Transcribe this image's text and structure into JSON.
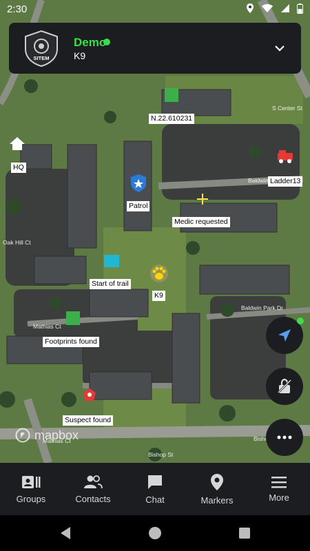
{
  "status_bar": {
    "time": "2:30"
  },
  "header": {
    "group_name": "Demo",
    "subtitle": "K9",
    "logo_text": "SITEM"
  },
  "map": {
    "markers": [
      {
        "label": "N.22.610231",
        "icon": "green-square-icon"
      },
      {
        "label": "HQ",
        "icon": "house-icon"
      },
      {
        "label": "Ladder13",
        "icon": "fire-truck-icon"
      },
      {
        "label": "Patrol",
        "icon": "police-badge-icon"
      },
      {
        "label": "Medic requested",
        "icon": "medical-cross-icon"
      },
      {
        "label": "Start of trail",
        "icon": "cyan-square-icon"
      },
      {
        "label": "K9",
        "icon": "paw-icon"
      },
      {
        "label": "Footprints found",
        "icon": "green-square-icon"
      },
      {
        "label": "Suspect found",
        "icon": "suspect-icon"
      }
    ],
    "street_labels": [
      "Baldwin Park Dr",
      "Baldwin Park Dr",
      "Mathias Ct",
      "Mathias Ct",
      "Bishop St",
      "Bishop St",
      "Oak Hill Ct",
      "S Center St"
    ],
    "attribution": "mapbox"
  },
  "nav": {
    "items": [
      {
        "label": "Groups",
        "icon": "groups-icon"
      },
      {
        "label": "Contacts",
        "icon": "contacts-icon"
      },
      {
        "label": "Chat",
        "icon": "chat-icon"
      },
      {
        "label": "Markers",
        "icon": "marker-pin-icon"
      },
      {
        "label": "More",
        "icon": "menu-icon"
      }
    ]
  },
  "colors": {
    "accent": "#3ddc4a",
    "panel": "#1c1d20",
    "marker_green": "#3daf4a",
    "marker_cyan": "#1fb8d4"
  }
}
